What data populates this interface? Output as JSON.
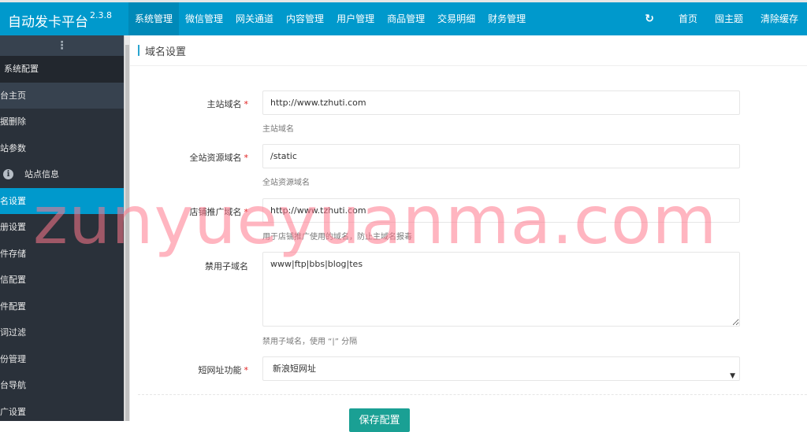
{
  "header": {
    "brand": "自动发卡平台",
    "version": "2.3.8",
    "nav": [
      {
        "label": "系统管理",
        "active": true
      },
      {
        "label": "微信管理"
      },
      {
        "label": "网关通道"
      },
      {
        "label": "内容管理"
      },
      {
        "label": "用户管理"
      },
      {
        "label": "商品管理"
      },
      {
        "label": "交易明细"
      },
      {
        "label": "财务管理"
      }
    ],
    "right": {
      "refresh_icon": "↻",
      "home": "首页",
      "theme": "囤主题",
      "clear_cache": "清除缓存"
    }
  },
  "sidebar": {
    "handle_icon": "⋮",
    "group": "系统配置",
    "items": [
      {
        "label": "台主页"
      },
      {
        "label": "据删除"
      },
      {
        "label": "站参数"
      },
      {
        "label": "站点信息",
        "icon": "info-icon"
      },
      {
        "label": "名设置",
        "active": true
      },
      {
        "label": "册设置"
      },
      {
        "label": "件存储"
      },
      {
        "label": "信配置"
      },
      {
        "label": "件配置"
      },
      {
        "label": "词过滤"
      },
      {
        "label": "份管理"
      },
      {
        "label": "台导航"
      },
      {
        "label": "广设置"
      }
    ]
  },
  "page": {
    "title": "域名设置",
    "fields": {
      "main_domain": {
        "label": "主站域名",
        "required": true,
        "value": "http://www.tzhuti.com",
        "help": "主站域名"
      },
      "static_domain": {
        "label": "全站资源域名",
        "required": true,
        "value": "/static",
        "help": "全站资源域名"
      },
      "shop_domain": {
        "label": "店铺推广域名",
        "required": true,
        "value": "http://www.tzhuti.com",
        "help": "用于店铺推广使用的域名，防止主域名报毒"
      },
      "banned_subdomains": {
        "label": "禁用子域名",
        "required": false,
        "value": "www|ftp|bbs|blog|tes",
        "help": "禁用子域名，使用 “|” 分隔"
      },
      "short_url": {
        "label": "短网址功能",
        "required": true,
        "value": "新浪短网址"
      }
    },
    "required_mark": "*",
    "select_arrow": "▼",
    "save_label": "保存配置"
  },
  "watermark": "zunyueyuanma.com"
}
